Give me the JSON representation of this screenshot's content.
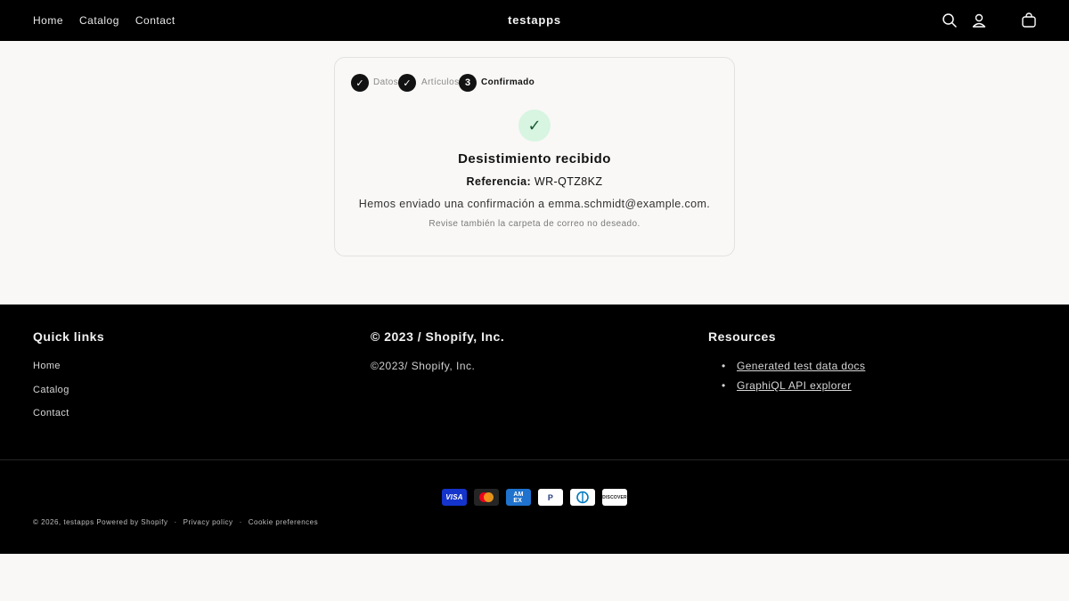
{
  "header": {
    "nav": [
      "Home",
      "Catalog",
      "Contact"
    ],
    "brand": "testapps",
    "icons": [
      "search-icon",
      "account-icon",
      "cart-icon"
    ]
  },
  "steps": [
    {
      "label": "Datos",
      "state": "done",
      "marker": "✓"
    },
    {
      "label": "Artículos",
      "state": "done",
      "marker": "✓"
    },
    {
      "label": "Confirmado",
      "state": "active",
      "marker": "3"
    }
  ],
  "confirmation": {
    "check": "✓",
    "title": "Desistimiento recibido",
    "reference_label": "Referencia:",
    "reference_value": "WR-QTZ8KZ",
    "sent_message": "Hemos enviado una confirmación a emma.schmidt@example.com.",
    "spam_note": "Revise también la carpeta de correo no deseado."
  },
  "footer": {
    "quick_links_title": "Quick links",
    "quick_links": [
      "Home",
      "Catalog",
      "Contact"
    ],
    "company_title": "© 2023 / Shopify, Inc.",
    "company_text": "©2023/ Shopify, Inc.",
    "resources_title": "Resources",
    "resources": [
      "Generated test data docs",
      "GraphiQL API explorer"
    ],
    "payment_methods": [
      "VISA",
      "Mastercard",
      "AMEX",
      "PayPal",
      "Diners Club",
      "DISCOVER"
    ],
    "copyright": "© 2026, testapps Powered by Shopify",
    "privacy": "Privacy policy",
    "cookies": "Cookie preferences",
    "separator": "·"
  },
  "colors": {
    "header_bg": "#000000",
    "page_bg": "#f9f8f6",
    "success_bg": "#d7f5e1",
    "success_fg": "#1a5c35"
  }
}
